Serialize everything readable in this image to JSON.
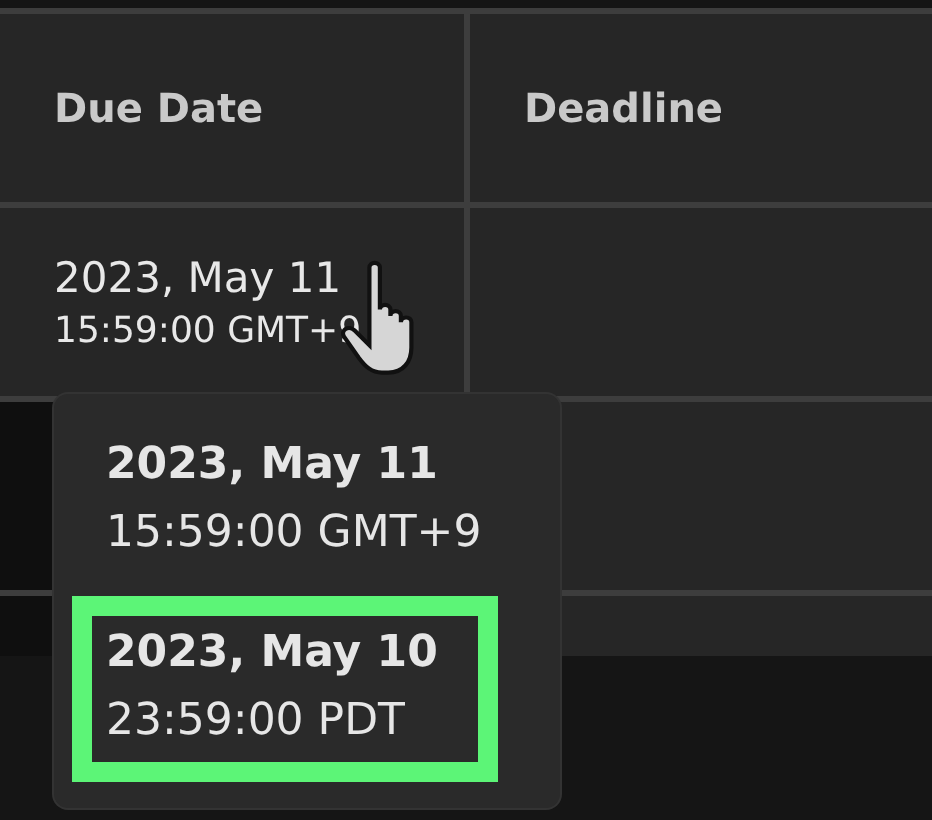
{
  "table": {
    "columns": [
      "Due Date",
      "Deadline"
    ],
    "rows": [
      {
        "cells": [
          {
            "date": "2023, May 11",
            "time": "15:59:00 GMT+9"
          },
          {}
        ]
      }
    ]
  },
  "tooltip": {
    "entries": [
      {
        "date": "2023, May 11",
        "time": "15:59:00 GMT+9",
        "highlighted": false
      },
      {
        "date": "2023, May 10",
        "time": "23:59:00 PDT",
        "highlighted": true
      }
    ]
  }
}
